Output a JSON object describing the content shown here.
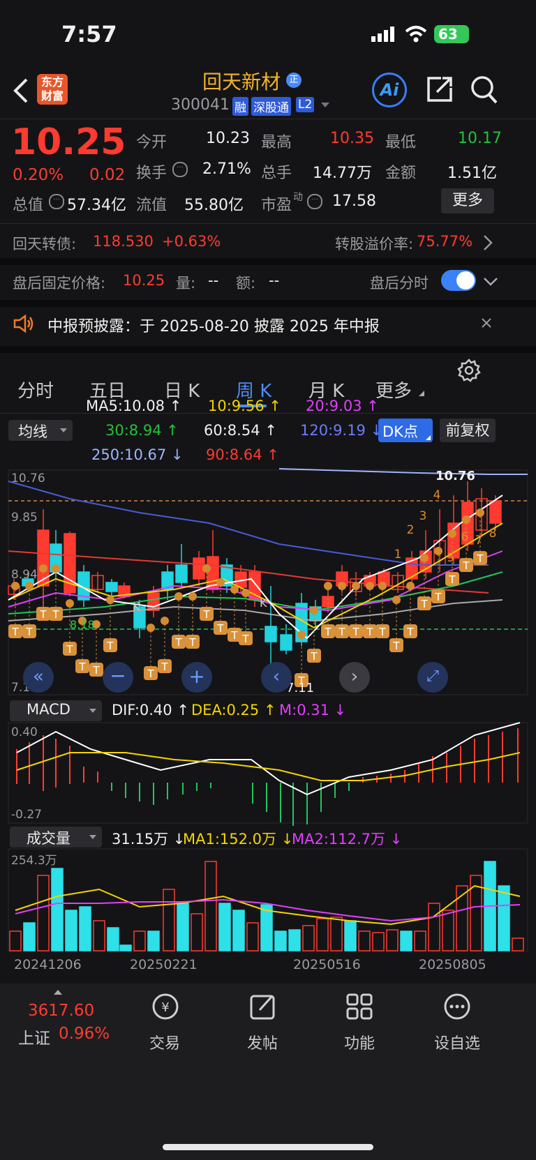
{
  "status_bar": {
    "time": "7:57",
    "battery": "63"
  },
  "header": {
    "logo_line1": "东方",
    "logo_line2": "财富",
    "stock_name": "回天新材",
    "name_badge": "正",
    "code": "300041",
    "tags": [
      "融",
      "深股通",
      "L2"
    ],
    "ai_label": "Ai"
  },
  "quote": {
    "price": "10.25",
    "change_pct": "0.20%",
    "change": "0.02",
    "open_label": "今开",
    "open": "10.23",
    "high_label": "最高",
    "high": "10.35",
    "low_label": "最低",
    "low": "10.17",
    "turnover_label": "换手",
    "turnover": "2.71%",
    "volume_label": "总手",
    "volume": "14.77万",
    "amount_label": "金额",
    "amount": "1.51亿",
    "mktcap_label": "总值",
    "mktcap": "57.34亿",
    "float_label": "流值",
    "float": "55.80亿",
    "pe_label": "市盈",
    "pe_sup": "动",
    "pe": "17.58",
    "more_label": "更多"
  },
  "bond": {
    "name": "回天转债:",
    "price": "118.530",
    "change": "+0.63%",
    "premium_label": "转股溢价率:",
    "premium": "75.77%"
  },
  "after_hours": {
    "label": "盘后固定价格:",
    "price": "10.25",
    "vol_label": "量:",
    "vol": "--",
    "amt_label": "额:",
    "amt": "--",
    "timeshare_label": "盘后分时",
    "toggle_on": true
  },
  "notice": {
    "text": "中报预披露：于 2025-08-20 披露 2025 年中报"
  },
  "tabs": {
    "items": [
      "分时",
      "五日",
      "日 K",
      "周 K",
      "月 K",
      "更多"
    ],
    "active": "周 K"
  },
  "ma_legend": {
    "ma5": "MA5:10.08 ↑",
    "ma10": "10:9.56 ↑",
    "ma20": "20:9.03 ↑",
    "ma30": "30:8.94 ↑",
    "ma60": "60:8.54 ↑",
    "ma120": "120:9.19 ↓",
    "ma250": "250:10.67 ↓",
    "ma90": "90:8.64 ↑",
    "selector": "均线",
    "dk_label": "DK点",
    "restore_label": "前复权"
  },
  "kchart": {
    "y_top": "10.76",
    "y_mid1": "9.85",
    "y_mid2": "8.94",
    "y_bottom": "7.11",
    "max_label": "10.76",
    "min_label": "7.11",
    "support_label": "8.18",
    "marker_digits": [
      "1",
      "2",
      "3",
      "4",
      "5",
      "6",
      "7",
      "8"
    ],
    "marker_t": "T",
    "marker_k": "K",
    "marker_s": "S",
    "colors": {
      "up": "#ff3b30",
      "down": "#22d3e0",
      "ma5": "#ffffff",
      "ma10": "#f5d400",
      "ma20": "#e040fb",
      "ma30": "#22c55e",
      "ma60": "#aaaaaa",
      "ma120": "#4a5bd6",
      "ma250": "#9db4ff",
      "ma90": "#e53935"
    }
  },
  "macd": {
    "selector": "MACD",
    "dif": "DIF:0.40 ↑",
    "dea": "DEA:0.25 ↑",
    "m": "M:0.31 ↓",
    "y_top": "0.40",
    "y_bottom": "-0.27"
  },
  "volume": {
    "selector": "成交量",
    "vol": "31.15万 ↓",
    "ma1": "MA1:152.0万 ↓",
    "ma2": "MA2:112.7万 ↓",
    "y_top": "254.3万",
    "dates": [
      "20241206",
      "20250221",
      "20250516",
      "20250805"
    ]
  },
  "bottom_nav": {
    "index_value": "3617.60",
    "index_name": "上证",
    "index_pct": "0.96%",
    "items": [
      "交易",
      "发帖",
      "功能",
      "设自选"
    ]
  }
}
